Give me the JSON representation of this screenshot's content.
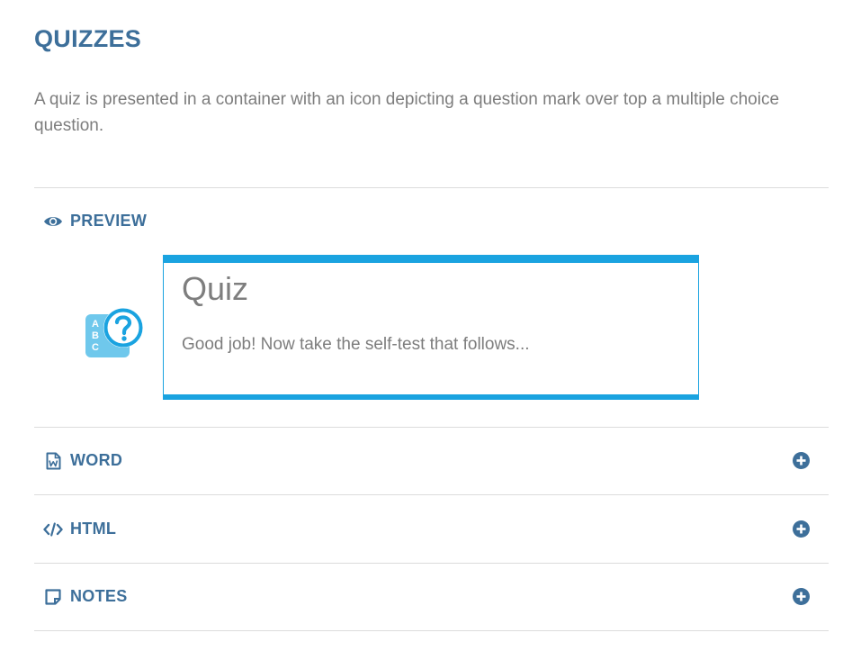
{
  "page": {
    "title": "QUIZZES",
    "intro": "A quiz is presented in a container with an icon depicting a question mark over top a multiple choice question."
  },
  "preview": {
    "label": "PREVIEW",
    "quiz": {
      "title": "Quiz",
      "text": "Good job! Now take the self-test that follows...",
      "icon_letters": [
        "A",
        "B",
        "C"
      ],
      "accent_color": "#1aa3e0"
    }
  },
  "sections": {
    "word": {
      "label": "WORD",
      "icon": "word-document-icon"
    },
    "html": {
      "label": "HTML",
      "icon": "code-icon"
    },
    "notes": {
      "label": "NOTES",
      "icon": "sticky-note-icon"
    }
  },
  "colors": {
    "heading": "#3d6f9a",
    "body_text": "#7d7d7d",
    "divider": "#dcdcdc"
  }
}
